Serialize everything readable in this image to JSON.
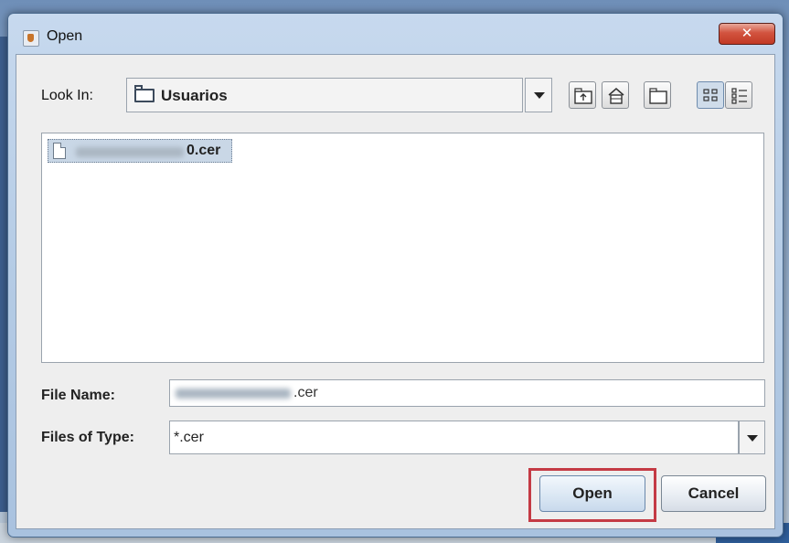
{
  "window": {
    "title": "Open",
    "close_glyph": "✕"
  },
  "look_in": {
    "label": "Look In:",
    "value": "Usuarios"
  },
  "toolbar": {
    "buttons": [
      {
        "icon": "up-folder-icon"
      },
      {
        "icon": "home-icon"
      },
      {
        "icon": "new-folder-icon"
      },
      {
        "icon": "list-view-icon",
        "pressed": true
      },
      {
        "icon": "details-view-icon"
      }
    ]
  },
  "files": [
    {
      "name_suffix": "0.cer",
      "selected": true,
      "name_obscured": true
    }
  ],
  "file_name": {
    "label": "File Name:",
    "value_suffix": ".cer",
    "value_obscured": true
  },
  "file_type": {
    "label": "Files of Type:",
    "value": "*.cer"
  },
  "buttons": {
    "open": "Open",
    "cancel": "Cancel"
  },
  "colors": {
    "highlight_box": "#c43a44",
    "selection": "#c9d7e6",
    "title_close": "#c23a25"
  }
}
